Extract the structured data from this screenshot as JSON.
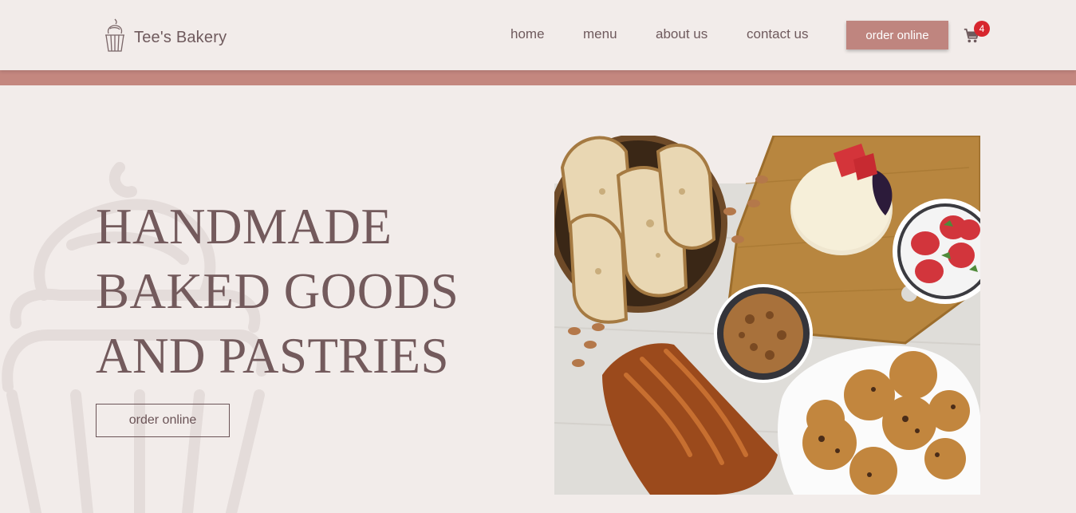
{
  "brand": {
    "name": "Tee's Bakery",
    "logo_icon": "cupcake-icon"
  },
  "nav": {
    "items": [
      "home",
      "menu",
      "about us",
      "contact us"
    ]
  },
  "header": {
    "order_label": "order online",
    "cart_icon": "cart-icon",
    "cart_count": "4"
  },
  "hero": {
    "headline": [
      "HANDMADE",
      "BAKED GOODS",
      "AND PASTRIES"
    ],
    "button_label": "order online",
    "image_subject": "baked goods spread"
  },
  "colors": {
    "background": "#f2ecea",
    "accent": "#c4877f",
    "button": "#bf857f",
    "text": "#6b5457",
    "badge": "#d7262e"
  }
}
